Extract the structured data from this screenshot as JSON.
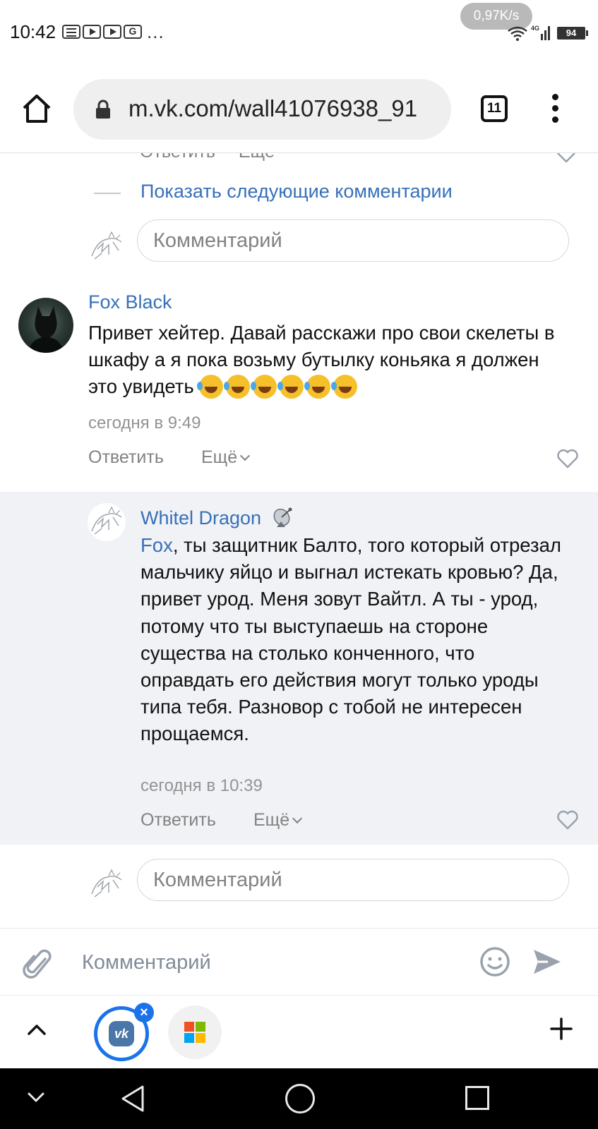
{
  "status_bar": {
    "time": "10:42",
    "more": "...",
    "net_speed": "0,97K/s",
    "network_type": "4G",
    "battery": "94",
    "notification_icons": [
      "document-icon",
      "play-icon",
      "play-icon",
      "ge-icon"
    ]
  },
  "browser": {
    "url": "m.vk.com/wall41076938_91",
    "tab_count": "11"
  },
  "page": {
    "cut_off_actions": {
      "reply": "Ответить",
      "more": "Ещё"
    },
    "show_more_label": "Показать следующие комментарии",
    "comment_placeholder": "Комментарий"
  },
  "comments": [
    {
      "author": "Fox Black",
      "text": "Привет хейтер. Давай расскажи про свои скелеты в шкафу а я пока возьму бутылку коньяка я должен это увидеть",
      "emoji_count": 6,
      "time": "сегодня в 9:49",
      "reply_label": "Ответить",
      "more_label": "Ещё"
    },
    {
      "author": "Whitel Dragon",
      "mention": "Fox",
      "text": ", ты защитник Балто, того который отрезал мальчику яйцо и выгнал истекать кровью? Да, привет урод. Меня зовут Вайтл. А ты - урод, потому что ты выступаешь на стороне существа на столько конченного, что оправдать его действия могут только уроды типа тебя. Разновор с тобой не интересен прощаемся.",
      "time": "сегодня в 10:39",
      "reply_label": "Ответить",
      "more_label": "Ещё"
    }
  ],
  "compose": {
    "placeholder": "Комментарий"
  },
  "colors": {
    "link": "#3770b8",
    "reply_bg": "#f0f2f5",
    "muted": "#828282",
    "tab_accent": "#1a73e8"
  }
}
